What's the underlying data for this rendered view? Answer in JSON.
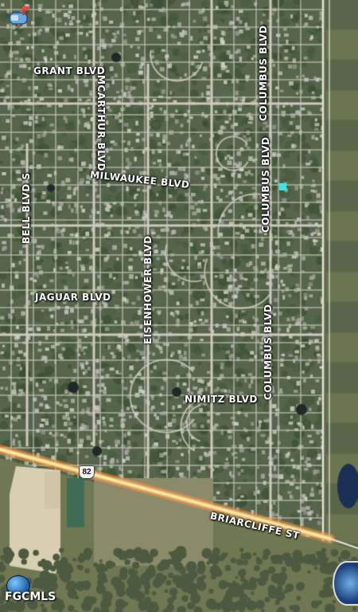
{
  "map": {
    "view": "satellite",
    "streets": [
      {
        "id": "grant",
        "label": "GRANT BLVD"
      },
      {
        "id": "mcarthur",
        "label": "MCARTHUR BLVD"
      },
      {
        "id": "columbus-1",
        "label": "COLUMBUS BLVD"
      },
      {
        "id": "columbus-2",
        "label": "COLUMBUS BLVD"
      },
      {
        "id": "milwaukee",
        "label": "MILWAUKEE BLVD"
      },
      {
        "id": "bell",
        "label": "BELL BLVD S"
      },
      {
        "id": "eisenhower",
        "label": "EISENHOWER BLVD"
      },
      {
        "id": "jaguar",
        "label": "JAGUAR BLVD"
      },
      {
        "id": "columbus-3",
        "label": "COLUMBUS BLVD"
      },
      {
        "id": "nimitz",
        "label": "NIMITZ BLVD"
      },
      {
        "id": "briarcliffe",
        "label": "BRIARCLIFFE ST"
      }
    ],
    "route_shield": "82",
    "marker_color": "#35e8e8",
    "watermark": "FGCMLS"
  },
  "icons": {
    "top_left": "mailbox-icon",
    "bottom_left": "globe-icon",
    "bottom_right": "street-view-camera-icon"
  }
}
